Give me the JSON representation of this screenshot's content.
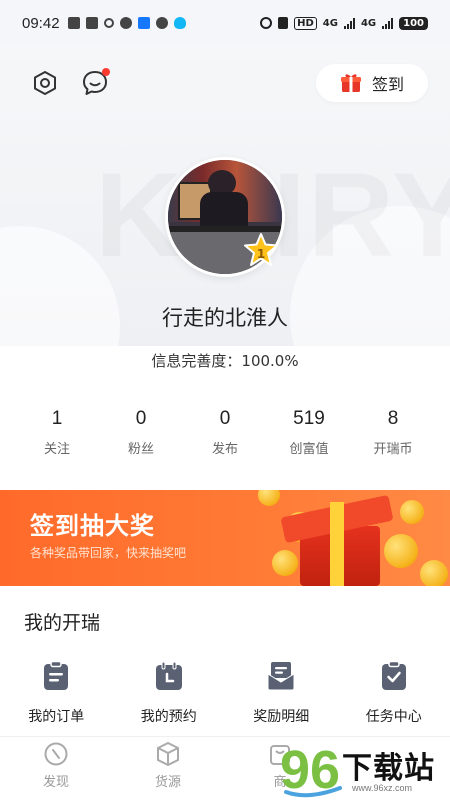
{
  "status_bar": {
    "time": "09:42",
    "network_label": "4G",
    "network_label_2": "4G",
    "hd_label": "HD",
    "battery": "100"
  },
  "header": {
    "checkin_label": "签到"
  },
  "profile": {
    "watermark": "KAIRY",
    "level": "1",
    "username": "行走的北淮人",
    "completeness_label": "信息完善度：",
    "completeness_value": "100.0%"
  },
  "stats": [
    {
      "value": "1",
      "label": "关注"
    },
    {
      "value": "0",
      "label": "粉丝"
    },
    {
      "value": "0",
      "label": "发布"
    },
    {
      "value": "519",
      "label": "创富值"
    },
    {
      "value": "8",
      "label": "开瑞币"
    }
  ],
  "banner": {
    "title": "签到抽大奖",
    "subtitle": "各种奖品带回家，快来抽奖吧"
  },
  "my_section": {
    "title": "我的开瑞",
    "items": [
      {
        "label": "我的订单",
        "icon": "order-icon"
      },
      {
        "label": "我的预约",
        "icon": "calendar-icon"
      },
      {
        "label": "奖励明细",
        "icon": "reward-icon"
      },
      {
        "label": "任务中心",
        "icon": "task-icon"
      }
    ]
  },
  "tabbar": {
    "items": [
      {
        "label": "发现",
        "icon": "discover-icon"
      },
      {
        "label": "货源",
        "icon": "box-icon"
      },
      {
        "label": "商",
        "icon": "shop-icon"
      }
    ]
  },
  "watermark_logo": {
    "number": "96",
    "text": "下载站",
    "url": "www.96xz.com"
  },
  "colors": {
    "accent": "#ff6a2a",
    "badge": "#ffc21a",
    "icon": "#5a6172"
  }
}
